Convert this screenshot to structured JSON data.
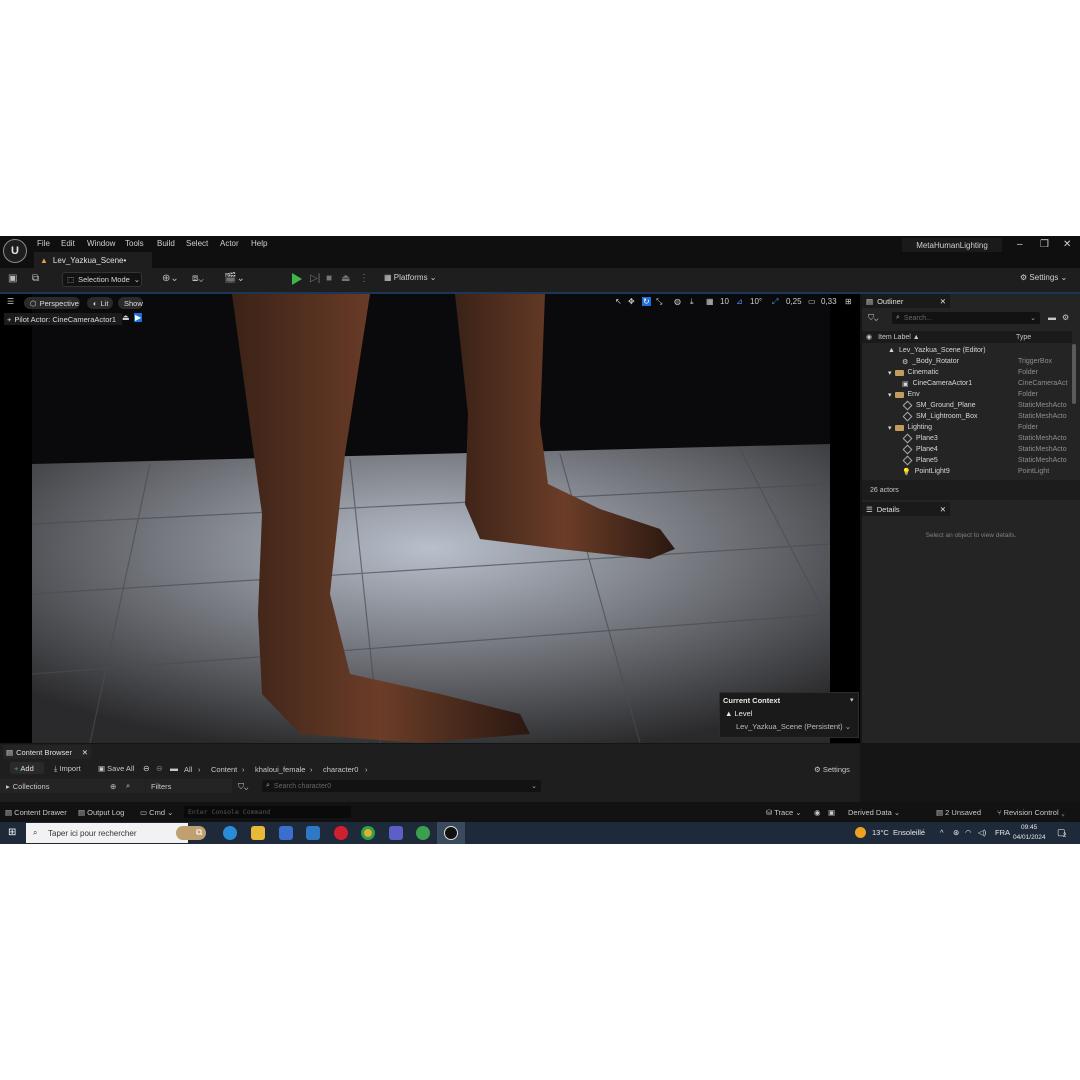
{
  "menubar": {
    "logo": "U",
    "items": [
      "File",
      "Edit",
      "Window",
      "Tools",
      "Build",
      "Select",
      "Actor",
      "Help"
    ],
    "level_tab": "Lev_Yazkua_Scene•",
    "project": "MetaHumanLighting"
  },
  "toolbar": {
    "selection_mode": "Selection Mode",
    "platforms": "Platforms",
    "settings": "Settings"
  },
  "viewport": {
    "perspective": "Perspective",
    "lit": "Lit",
    "show": "Show",
    "pilot": "Pilot Actor: CineCameraActor1",
    "grid_snap": "10",
    "rotation_snap": "10°",
    "scale_snap": "0,25",
    "camera_speed": "0,33",
    "context_title": "Current Context",
    "context_level_label": "Level",
    "context_level_value": "Lev_Yazkua_Scene (Persistent)"
  },
  "outliner": {
    "title": "Outliner",
    "search_placeholder": "Search...",
    "col_label": "Item Label ▲",
    "col_type": "Type",
    "rows": [
      {
        "label": "Lev_Yazkua_Scene (Editor)",
        "type": ""
      },
      {
        "label": "_Body_Rotator",
        "type": "TriggerBox"
      },
      {
        "label": "Cinematic",
        "type": "Folder"
      },
      {
        "label": "CineCameraActor1",
        "type": "CineCameraAct"
      },
      {
        "label": "Env",
        "type": "Folder"
      },
      {
        "label": "SM_Ground_Plane",
        "type": "StaticMeshActo"
      },
      {
        "label": "SM_Lightroom_Box",
        "type": "StaticMeshActo"
      },
      {
        "label": "Lighting",
        "type": "Folder"
      },
      {
        "label": "Plane3",
        "type": "StaticMeshActo"
      },
      {
        "label": "Plane4",
        "type": "StaticMeshActo"
      },
      {
        "label": "Plane5",
        "type": "StaticMeshActo"
      },
      {
        "label": "PointLight9",
        "type": "PointLight"
      }
    ],
    "count": "26 actors"
  },
  "details": {
    "title": "Details",
    "empty": "Select an object to view details."
  },
  "content_browser": {
    "tab": "Content Browser",
    "add": "Add",
    "import": "Import",
    "save_all": "Save All",
    "path": [
      "All",
      "Content",
      "khaloui_female",
      "character0"
    ],
    "settings": "Settings",
    "collections": "Collections",
    "filters": "Filters",
    "search_placeholder": "Search character0"
  },
  "statusbar": {
    "content_drawer": "Content Drawer",
    "output_log": "Output Log",
    "cmd": "Cmd",
    "console_placeholder": "Enter Console Command",
    "trace": "Trace",
    "derived_data": "Derived Data",
    "unsaved": "2 Unsaved",
    "revision": "Revision Control"
  },
  "taskbar": {
    "search": "Taper ici pour rechercher",
    "weather_temp": "13°C",
    "weather_text": "Ensoleillé",
    "lang": "FRA",
    "time": "09:45",
    "date": "04/01/2024",
    "notif": "2"
  }
}
